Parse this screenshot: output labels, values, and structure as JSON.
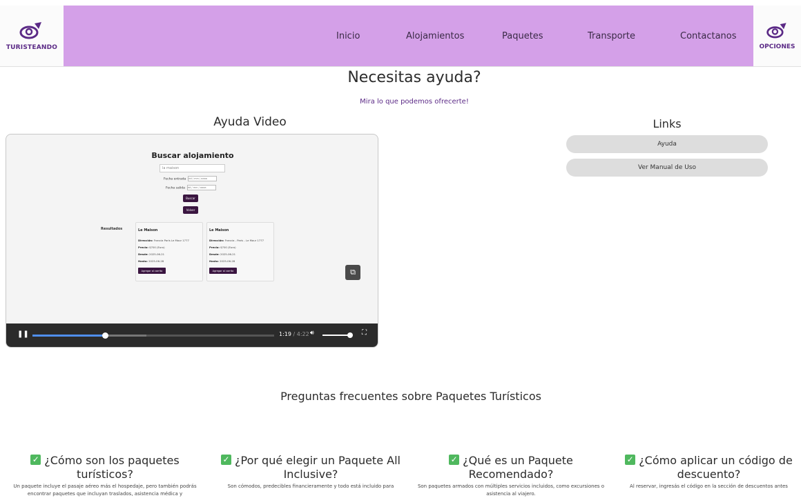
{
  "header": {
    "logo_text": "TURISTEANDO",
    "nav": [
      "Inicio",
      "Alojamientos",
      "Paquetes",
      "Transporte",
      "Contactanos"
    ],
    "options_text": "OPCIONES",
    "colors": {
      "navbar": "#d4a0e8",
      "brand": "#5b2a86"
    }
  },
  "main": {
    "title": "Necesitas ayuda?",
    "subtitle": "Mira lo que podemos ofrecerte!",
    "video_title": "Ayuda Video",
    "links_title": "Links",
    "links": [
      "Ayuda",
      "Ver Manual de Uso"
    ]
  },
  "video": {
    "heading": "Buscar alojamiento",
    "search_value": "la maison",
    "checkin_label": "Fecha entrada",
    "checkout_label": "Fecha salida",
    "date_placeholder": "dd / mm / aaaa",
    "search_button": "Buscar",
    "clear_button": "Volver",
    "results_label": "Resultados",
    "results": [
      {
        "name": "Le Maison",
        "address_label": "Dirección:",
        "address": "Francia París Le Mour 1777",
        "price_label": "Precio:",
        "price": "$700 (Euro)",
        "from_label": "Desde:",
        "from": "2025-06-21",
        "to_label": "Hasta:",
        "to": "2025-06-28",
        "button": "Agregar al carrito"
      },
      {
        "name": "Le Maison",
        "address_label": "Dirección:",
        "address": "Francia - París - Le Mour 1777",
        "price_label": "Precio:",
        "price": "$700 (Euro)",
        "from_label": "Desde:",
        "from": "2025-06-21",
        "to_label": "Hasta:",
        "to": "2025-06-28",
        "button": "Agregar al carrito"
      }
    ],
    "current_time": "1:19",
    "duration": "4:22",
    "progress_fraction": 0.3,
    "buffered_fraction": 0.47,
    "volume_fraction": 1.0
  },
  "faq": {
    "title": "Preguntas frecuentes sobre Paquetes Turísticos",
    "items": [
      {
        "question": "¿Cómo son los paquetes turísticos?",
        "answer": "Un paquete incluye el pasaje aéreo más el hospedaje, pero también podrás encontrar paquetes que incluyan traslados, asistencia médica y"
      },
      {
        "question": "¿Por qué elegir un Paquete All Inclusive?",
        "answer": "Son cómodos, predecibles financieramente y todo está incluido para"
      },
      {
        "question": "¿Qué es un Paquete Recomendado?",
        "answer": "Son paquetes armados con múltiples servicios incluidos, como excursiones o asistencia al viajero."
      },
      {
        "question": "¿Cómo aplicar un código de descuento?",
        "answer": "Al reservar, ingresás el código en la sección de descuentos antes"
      }
    ]
  }
}
